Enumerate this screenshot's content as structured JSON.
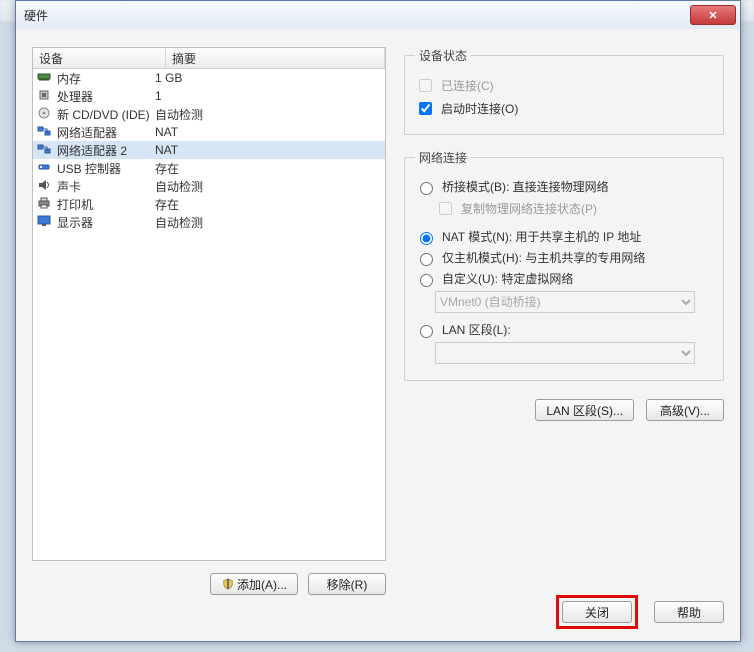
{
  "window": {
    "title": "硬件",
    "close_glyph": "✕"
  },
  "device_table": {
    "col_device": "设备",
    "col_summary": "摘要",
    "rows": [
      {
        "icon": "memory-icon",
        "name": "内存",
        "summary": "1 GB"
      },
      {
        "icon": "cpu-icon",
        "name": "处理器",
        "summary": "1"
      },
      {
        "icon": "disc-icon",
        "name": "新 CD/DVD (IDE)",
        "summary": "自动检测"
      },
      {
        "icon": "net-icon",
        "name": "网络适配器",
        "summary": "NAT"
      },
      {
        "icon": "net-icon",
        "name": "网络适配器 2",
        "summary": "NAT",
        "selected": true
      },
      {
        "icon": "usb-icon",
        "name": "USB 控制器",
        "summary": "存在"
      },
      {
        "icon": "sound-icon",
        "name": "声卡",
        "summary": "自动检测"
      },
      {
        "icon": "printer-icon",
        "name": "打印机",
        "summary": "存在"
      },
      {
        "icon": "display-icon",
        "name": "显示器",
        "summary": "自动检测"
      }
    ],
    "add_label": "添加(A)...",
    "remove_label": "移除(R)"
  },
  "device_status": {
    "legend": "设备状态",
    "connected_label": "已连接(C)",
    "connected_checked": false,
    "connected_enabled": false,
    "connect_at_poweron_label": "启动时连接(O)",
    "connect_at_poweron_checked": true
  },
  "network_connection": {
    "legend": "网络连接",
    "bridged_label": "桥接模式(B): 直接连接物理网络",
    "replicate_label": "复制物理网络连接状态(P)",
    "replicate_enabled": false,
    "nat_label": "NAT 模式(N): 用于共享主机的 IP 地址",
    "hostonly_label": "仅主机模式(H): 与主机共享的专用网络",
    "custom_label": "自定义(U): 特定虚拟网络",
    "custom_combo_selected": "VMnet0 (自动桥接)",
    "lan_segment_label": "LAN 区段(L):",
    "lan_segment_combo_selected": "",
    "selected_mode": "nat",
    "lan_segments_btn": "LAN 区段(S)...",
    "advanced_btn": "高级(V)..."
  },
  "footer": {
    "close_label": "关闭",
    "help_label": "帮助"
  },
  "colors": {
    "selection": "#d6e5f3",
    "highlight_box": "#e20808"
  }
}
